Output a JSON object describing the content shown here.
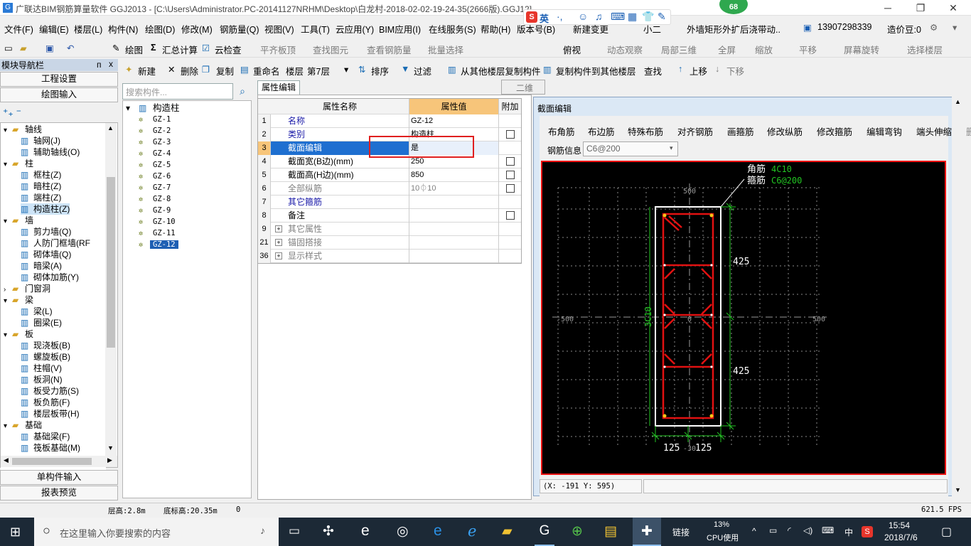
{
  "app": {
    "title": "广联达BIM钢筋算量软件 GGJ2013 - [C:\\Users\\Administrator.PC-20141127NRHM\\Desktop\\白龙村-2018-02-02-19-24-35(2666版).GGJ12]",
    "badge": "68"
  },
  "menu": [
    "文件(F)",
    "编辑(E)",
    "楼层(L)",
    "构件(N)",
    "绘图(D)",
    "修改(M)",
    "钢筋量(Q)",
    "视图(V)",
    "工具(T)",
    "云应用(Y)",
    "BIM应用(I)",
    "在线服务(S)",
    "帮助(H)",
    "版本号(B)",
    "新建变更",
    "小二"
  ],
  "menu_extra": {
    "notice": "外墙矩形外扩后浇带动..",
    "phone": "13907298339",
    "beans": "造价豆:0"
  },
  "ime": "英",
  "toolbar1": [
    "绘图",
    "汇总计算",
    "云检查",
    "平齐板顶",
    "查找图元",
    "查看钢筋量",
    "批量选择",
    "二维",
    "俯视",
    "动态观察",
    "局部三维",
    "全屏",
    "缩放",
    "平移",
    "屏幕旋转",
    "选择楼层"
  ],
  "toolbar2": {
    "new": "新建",
    "delete": "删除",
    "copy": "复制",
    "rename": "重命名",
    "floor_label": "楼层",
    "floor_value": "第7层",
    "sort": "排序",
    "filter": "过滤",
    "copy_from": "从其他楼层复制构件",
    "copy_to": "复制构件到其他楼层",
    "find": "查找",
    "up": "上移",
    "down": "下移"
  },
  "nav": {
    "title": "模块导航栏",
    "pin": "ᴨ",
    "close": "x",
    "btn_settings": "工程设置",
    "btn_draw": "绘图输入",
    "btn_single": "单构件输入",
    "btn_report": "报表预览",
    "tree": [
      {
        "l": 0,
        "t": "轴线",
        "e": "-"
      },
      {
        "l": 1,
        "t": "轴网(J)"
      },
      {
        "l": 1,
        "t": "辅助轴线(O)"
      },
      {
        "l": 0,
        "t": "柱",
        "e": "-"
      },
      {
        "l": 1,
        "t": "框柱(Z)"
      },
      {
        "l": 1,
        "t": "暗柱(Z)"
      },
      {
        "l": 1,
        "t": "端柱(Z)"
      },
      {
        "l": 1,
        "t": "构造柱(Z)",
        "s": true
      },
      {
        "l": 0,
        "t": "墙",
        "e": "-"
      },
      {
        "l": 1,
        "t": "剪力墙(Q)"
      },
      {
        "l": 1,
        "t": "人防门框墙(RF"
      },
      {
        "l": 1,
        "t": "砌体墙(Q)"
      },
      {
        "l": 1,
        "t": "暗梁(A)"
      },
      {
        "l": 1,
        "t": "砌体加筋(Y)"
      },
      {
        "l": 0,
        "t": "门窗洞",
        "e": "+"
      },
      {
        "l": 0,
        "t": "梁",
        "e": "-"
      },
      {
        "l": 1,
        "t": "梁(L)"
      },
      {
        "l": 1,
        "t": "圈梁(E)"
      },
      {
        "l": 0,
        "t": "板",
        "e": "-"
      },
      {
        "l": 1,
        "t": "现浇板(B)"
      },
      {
        "l": 1,
        "t": "螺旋板(B)"
      },
      {
        "l": 1,
        "t": "柱帽(V)"
      },
      {
        "l": 1,
        "t": "板洞(N)"
      },
      {
        "l": 1,
        "t": "板受力筋(S)"
      },
      {
        "l": 1,
        "t": "板负筋(F)"
      },
      {
        "l": 1,
        "t": "楼层板带(H)"
      },
      {
        "l": 0,
        "t": "基础",
        "e": "-"
      },
      {
        "l": 1,
        "t": "基础梁(F)"
      },
      {
        "l": 1,
        "t": "筏板基础(M)"
      }
    ]
  },
  "components": {
    "search_placeholder": "搜索构件...",
    "root": "构造柱",
    "items": [
      "GZ-1",
      "GZ-2",
      "GZ-3",
      "GZ-4",
      "GZ-5",
      "GZ-6",
      "GZ-7",
      "GZ-8",
      "GZ-9",
      "GZ-10",
      "GZ-11",
      "GZ-12"
    ],
    "selected": "GZ-12"
  },
  "props": {
    "tab": "属性编辑",
    "h_name": "属性名称",
    "h_value": "属性值",
    "h_extra": "附加",
    "rows": [
      {
        "n": "1",
        "name": "名称",
        "val": "GZ-12",
        "chk": false,
        "style": "blue"
      },
      {
        "n": "2",
        "name": "类别",
        "val": "构造柱",
        "chk": true,
        "style": "blue"
      },
      {
        "n": "3",
        "name": "截面编辑",
        "val": "是",
        "chk": false,
        "style": "sel"
      },
      {
        "n": "4",
        "name": "截面宽(B边)(mm)",
        "val": "250",
        "chk": true,
        "style": "norm"
      },
      {
        "n": "5",
        "name": "截面高(H边)(mm)",
        "val": "850",
        "chk": true,
        "style": "norm"
      },
      {
        "n": "6",
        "name": "全部纵筋",
        "val": "10⏀10",
        "chk": true,
        "style": "gray"
      },
      {
        "n": "7",
        "name": "其它箍筋",
        "val": "",
        "chk": false,
        "style": "blue"
      },
      {
        "n": "8",
        "name": "备注",
        "val": "",
        "chk": true,
        "style": "norm"
      },
      {
        "n": "9",
        "name": "其它属性",
        "val": "",
        "chk": false,
        "style": "grp"
      },
      {
        "n": "21",
        "name": "锚固搭接",
        "val": "",
        "chk": false,
        "style": "grp"
      },
      {
        "n": "36",
        "name": "显示样式",
        "val": "",
        "chk": false,
        "style": "grp"
      }
    ]
  },
  "section": {
    "title": "截面编辑",
    "tools": [
      "布角筋",
      "布边筋",
      "特殊布筋",
      "对齐钢筋",
      "画箍筋",
      "修改纵筋",
      "修改箍筋",
      "编辑弯钩",
      "端头伸缩",
      "删除"
    ],
    "info_label": "钢筋信息",
    "info_value": "C6@200",
    "lbl_corner": "角筋",
    "val_corner": "4C10",
    "lbl_stirrup": "箍筋",
    "val_stirrup": "C6@200",
    "dim_top": "425",
    "dim_bot": "425",
    "dim_left": "3C10",
    "dim_w1": "125",
    "dim_w2": "125",
    "grid_500": "500",
    "grid_m500": "-500",
    "grid_r500": "500",
    "grid_0": "0",
    "grid_b": "-30",
    "coords": "(X: -191 Y: 595)"
  },
  "status": {
    "floor_h": "层高:2.8m",
    "base_h": "底标高:20.35m",
    "n": "0",
    "fps": "621.5 FPS"
  },
  "taskbar": {
    "search": "在这里输入你要搜索的内容",
    "link": "链接",
    "cpu": "13%",
    "cpu_label": "CPU使用",
    "lang": "中",
    "time": "15:54",
    "date": "2018/7/6"
  },
  "colors": {
    "red": "#e11111",
    "green": "#22c322",
    "white": "#ffffff",
    "grid": "#8a8a8a"
  }
}
